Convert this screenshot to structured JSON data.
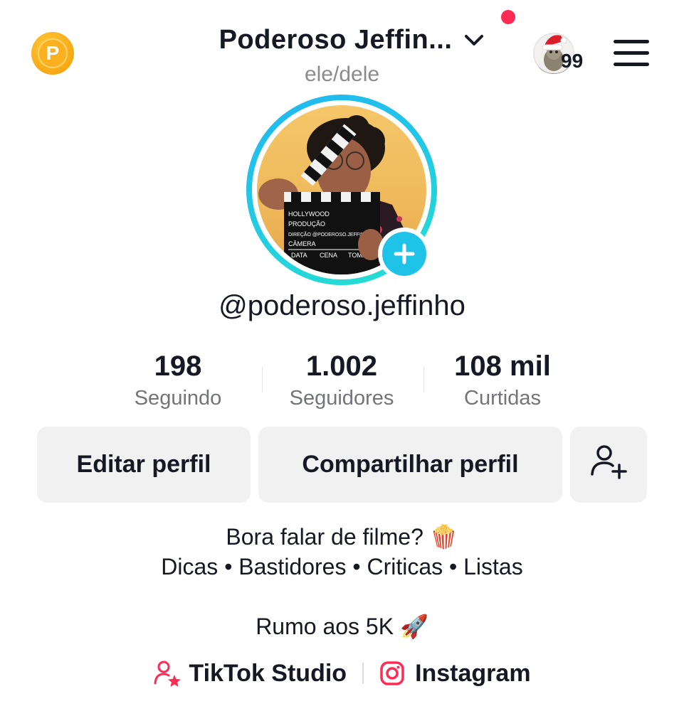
{
  "header": {
    "title": "Poderoso Jeffin...",
    "pronouns": "ele/dele",
    "coin_icon": "P",
    "story_count": "99",
    "colors": {
      "notification": "#fe2c55",
      "coin": "#f7a812"
    }
  },
  "profile": {
    "username": "@poderoso.jeffinho",
    "ring_colors": [
      "#20b7f0",
      "#25e0d0"
    ],
    "clapper_text": [
      "HOLLYWOOD",
      "PRODUÇÃO",
      "DIREÇÃO @PODEROSO.JEFFINHO",
      "CÂMERA",
      "DATA",
      "CENA",
      "TOMADA"
    ]
  },
  "stats": [
    {
      "value": "198",
      "label": "Seguindo"
    },
    {
      "value": "1.002",
      "label": "Seguidores"
    },
    {
      "value": "108 mil",
      "label": "Curtidas"
    }
  ],
  "actions": {
    "edit": "Editar perfil",
    "share": "Compartilhar perfil",
    "add_friends_icon": "person-add-icon"
  },
  "bio": {
    "line1": "Bora falar de filme? 🍿",
    "line2": "Dicas • Bastidores • Criticas • Listas",
    "line3": "Rumo aos 5K 🚀"
  },
  "links": {
    "studio": "TikTok Studio",
    "instagram": "Instagram",
    "colors": {
      "accent": "#fe2c55"
    }
  }
}
